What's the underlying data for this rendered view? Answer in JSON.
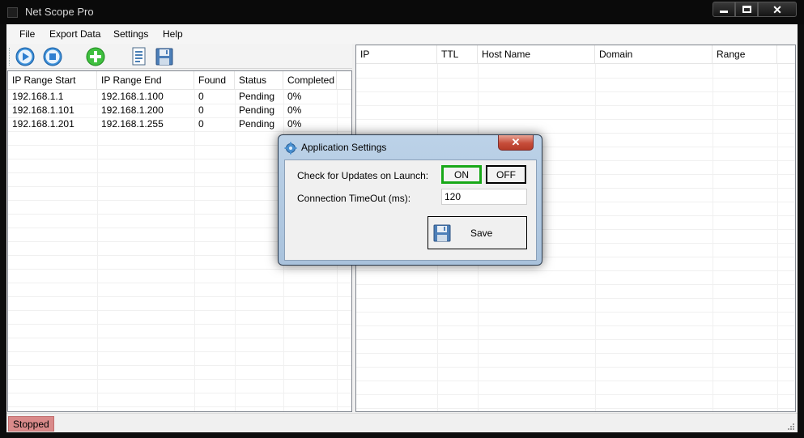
{
  "window": {
    "title": "Net Scope Pro"
  },
  "menu": {
    "file": "File",
    "export": "Export Data",
    "settings": "Settings",
    "help": "Help"
  },
  "toolbar": {
    "buttons": [
      "play-icon",
      "stop-icon",
      "add-icon",
      "report-icon",
      "save-icon"
    ]
  },
  "ranges": {
    "columns": [
      "IP Range Start",
      "IP Range End",
      "Found",
      "Status",
      "Completed"
    ],
    "rows": [
      [
        "192.168.1.1",
        "192.168.1.100",
        "0",
        "Pending",
        "0%"
      ],
      [
        "192.168.1.101",
        "192.168.1.200",
        "0",
        "Pending",
        "0%"
      ],
      [
        "192.168.1.201",
        "192.168.1.255",
        "0",
        "Pending",
        "0%"
      ]
    ]
  },
  "results": {
    "columns": [
      "IP",
      "TTL",
      "Host Name",
      "Domain",
      "Range"
    ]
  },
  "status": {
    "text": "Stopped",
    "color": "#d98a8a"
  },
  "dialog": {
    "title": "Application Settings",
    "close": "✕",
    "updates_label": "Check for Updates on Launch:",
    "on_label": "ON",
    "off_label": "OFF",
    "on_selected": true,
    "timeout_label": "Connection TimeOut (ms):",
    "timeout_value": "120",
    "save_label": "Save",
    "selected_color": "#18a818"
  }
}
